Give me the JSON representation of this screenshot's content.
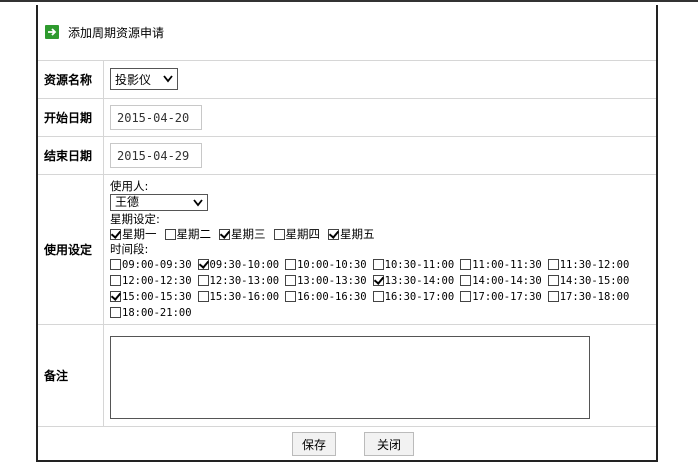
{
  "title": "添加周期资源申请",
  "resource": {
    "label": "资源名称",
    "value": "投影仪"
  },
  "start_date": {
    "label": "开始日期",
    "value": "2015-04-20"
  },
  "end_date": {
    "label": "结束日期",
    "value": "2015-04-29"
  },
  "usage": {
    "label": "使用设定",
    "user_label": "使用人:",
    "user_value": "王德",
    "week_label": "星期设定:",
    "days": [
      {
        "label": "星期一",
        "checked": true
      },
      {
        "label": "星期二",
        "checked": false
      },
      {
        "label": "星期三",
        "checked": true
      },
      {
        "label": "星期四",
        "checked": false
      },
      {
        "label": "星期五",
        "checked": true
      }
    ],
    "slots_label": "时间段:",
    "slots": [
      {
        "label": "09:00-09:30",
        "checked": false
      },
      {
        "label": "09:30-10:00",
        "checked": true
      },
      {
        "label": "10:00-10:30",
        "checked": false
      },
      {
        "label": "10:30-11:00",
        "checked": false
      },
      {
        "label": "11:00-11:30",
        "checked": false
      },
      {
        "label": "11:30-12:00",
        "checked": false
      },
      {
        "label": "12:00-12:30",
        "checked": false
      },
      {
        "label": "12:30-13:00",
        "checked": false
      },
      {
        "label": "13:00-13:30",
        "checked": false
      },
      {
        "label": "13:30-14:00",
        "checked": true
      },
      {
        "label": "14:00-14:30",
        "checked": false
      },
      {
        "label": "14:30-15:00",
        "checked": false
      },
      {
        "label": "15:00-15:30",
        "checked": true
      },
      {
        "label": "15:30-16:00",
        "checked": false
      },
      {
        "label": "16:00-16:30",
        "checked": false
      },
      {
        "label": "16:30-17:00",
        "checked": false
      },
      {
        "label": "17:00-17:30",
        "checked": false
      },
      {
        "label": "17:30-18:00",
        "checked": false
      },
      {
        "label": "18:00-21:00",
        "checked": false
      }
    ]
  },
  "notes": {
    "label": "备注",
    "value": ""
  },
  "buttons": {
    "save": "保存",
    "close": "关闭"
  },
  "colors": {
    "accent_icon": "#2e9a2e",
    "border": "#d6d6d6"
  }
}
